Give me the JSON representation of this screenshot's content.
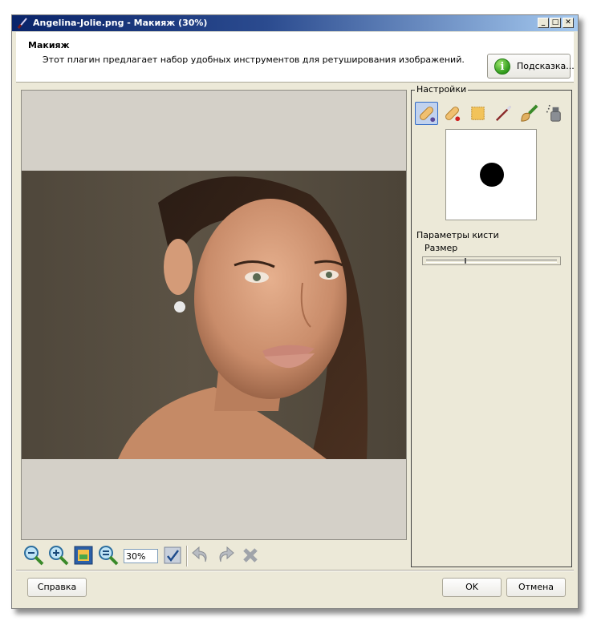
{
  "window": {
    "title": "Angelina-Jolie.png - Макияж (30%)",
    "controls": {
      "minimize": "_",
      "maximize": "□",
      "close": "✕"
    }
  },
  "header": {
    "title": "Макияж",
    "description": "Этот плагин предлагает набор удобных инструментов для ретуширования изображений.",
    "hint_button": "Подсказка..."
  },
  "toolbar": {
    "buttons": [
      "zoom-out-icon",
      "zoom-in-icon",
      "fit-to-window-icon",
      "actual-size-icon"
    ],
    "zoom_value": "30%",
    "actions": [
      "apply-icon",
      "undo-icon",
      "redo-icon",
      "delete-icon"
    ]
  },
  "settings": {
    "legend": "Настройки",
    "tools": [
      "plaster-brush-icon",
      "red-plaster-icon",
      "sponge-icon",
      "thin-brush-icon",
      "makeup-brush-icon",
      "spray-icon"
    ],
    "active_tool_index": 0,
    "brush_params_label": "Параметры кисти",
    "size_label": "Размер",
    "size_fraction": 0.3
  },
  "footer": {
    "help_button": "Справка",
    "ok_button": "OK",
    "cancel_button": "Отмена"
  },
  "colors": {
    "titlebar_start": "#0a246a",
    "titlebar_end": "#a6caf0",
    "dialog_background": "#ece9d8",
    "preview_background": "#d4d0c8"
  }
}
